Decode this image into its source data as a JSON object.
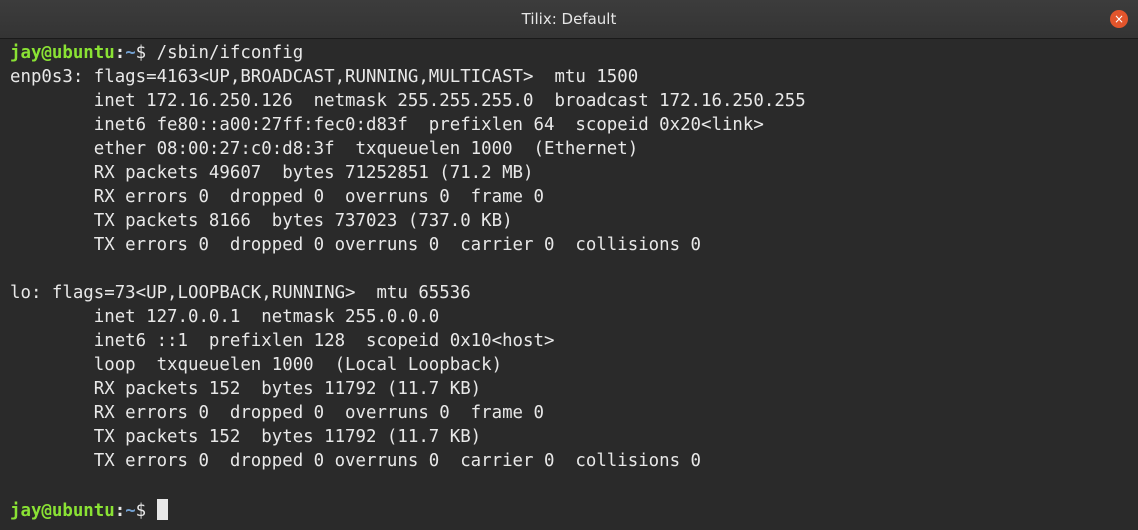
{
  "window": {
    "title": "Tilix: Default",
    "close_icon": "×"
  },
  "prompt": {
    "user_host": "jay@ubuntu",
    "separator": ":",
    "path": "~",
    "symbol": "$ "
  },
  "command": "/sbin/ifconfig",
  "output": [
    "enp0s3: flags=4163<UP,BROADCAST,RUNNING,MULTICAST>  mtu 1500",
    "        inet 172.16.250.126  netmask 255.255.255.0  broadcast 172.16.250.255",
    "        inet6 fe80::a00:27ff:fec0:d83f  prefixlen 64  scopeid 0x20<link>",
    "        ether 08:00:27:c0:d8:3f  txqueuelen 1000  (Ethernet)",
    "        RX packets 49607  bytes 71252851 (71.2 MB)",
    "        RX errors 0  dropped 0  overruns 0  frame 0",
    "        TX packets 8166  bytes 737023 (737.0 KB)",
    "        TX errors 0  dropped 0 overruns 0  carrier 0  collisions 0",
    "",
    "lo: flags=73<UP,LOOPBACK,RUNNING>  mtu 65536",
    "        inet 127.0.0.1  netmask 255.0.0.0",
    "        inet6 ::1  prefixlen 128  scopeid 0x10<host>",
    "        loop  txqueuelen 1000  (Local Loopback)",
    "        RX packets 152  bytes 11792 (11.7 KB)",
    "        RX errors 0  dropped 0  overruns 0  frame 0",
    "        TX packets 152  bytes 11792 (11.7 KB)",
    "        TX errors 0  dropped 0 overruns 0  carrier 0  collisions 0",
    ""
  ],
  "colors": {
    "prompt_user": "#8ae234",
    "prompt_path": "#729fcf",
    "text": "#e8e8e8",
    "close_button": "#e2552c"
  }
}
